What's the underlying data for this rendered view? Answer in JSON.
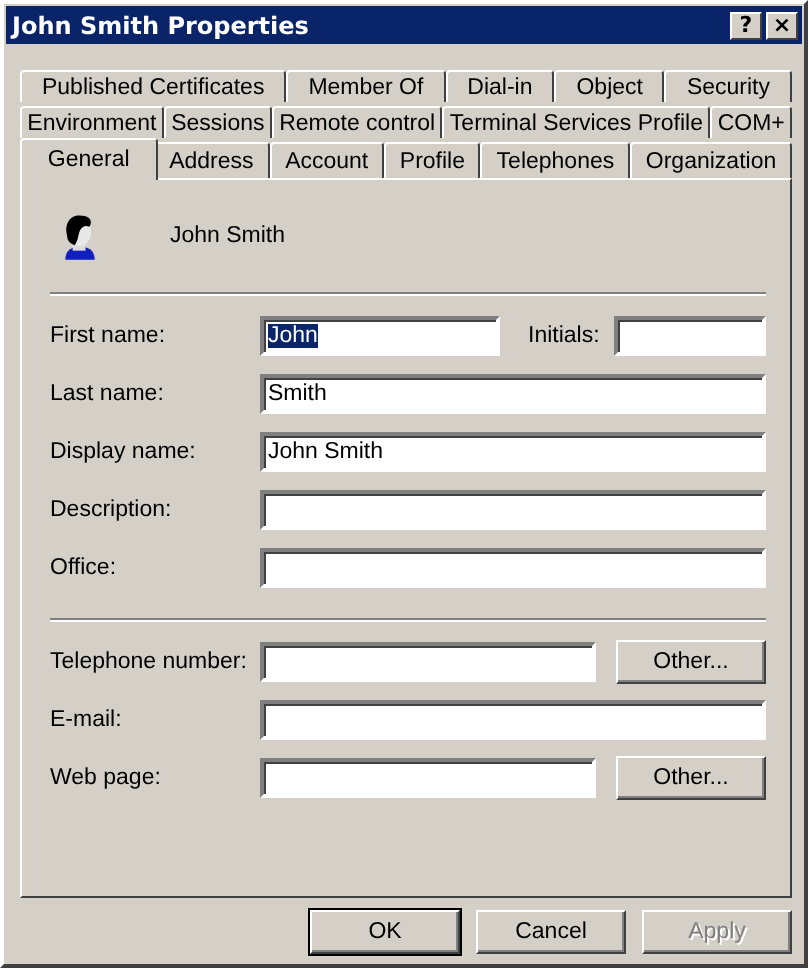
{
  "window": {
    "title": "John Smith Properties",
    "title_buttons": [
      "?",
      "×"
    ]
  },
  "tab_rows": [
    [
      {
        "label": "Published Certificates",
        "selected": false
      },
      {
        "label": "Member Of",
        "selected": false
      },
      {
        "label": "Dial-in",
        "selected": false
      },
      {
        "label": "Object",
        "selected": false
      },
      {
        "label": "Security",
        "selected": false
      }
    ],
    [
      {
        "label": "Environment",
        "selected": false
      },
      {
        "label": "Sessions",
        "selected": false
      },
      {
        "label": "Remote control",
        "selected": false
      },
      {
        "label": "Terminal Services Profile",
        "selected": false
      },
      {
        "label": "COM+",
        "selected": false
      }
    ],
    [
      {
        "label": "General",
        "selected": true
      },
      {
        "label": "Address",
        "selected": false
      },
      {
        "label": "Account",
        "selected": false
      },
      {
        "label": "Profile",
        "selected": false
      },
      {
        "label": "Telephones",
        "selected": false
      },
      {
        "label": "Organization",
        "selected": false
      }
    ]
  ],
  "header": {
    "name": "John Smith"
  },
  "groups": [
    {
      "rows": [
        {
          "label": "First name:",
          "value": "John",
          "text_selected": true,
          "side_field": {
            "label": "Initials:"
          }
        },
        {
          "label": "Last name:",
          "value": "Smith",
          "text_selected": false
        },
        {
          "label": "Display name:",
          "value": "John Smith",
          "text_selected": false
        },
        {
          "label": "Description:"
        },
        {
          "label": "Office:"
        }
      ]
    },
    {
      "rows": [
        {
          "label": "Telephone number:",
          "button": "Other..."
        },
        {
          "label": "E-mail:"
        },
        {
          "label": "Web page:",
          "button": "Other..."
        }
      ]
    }
  ],
  "buttons": [
    {
      "label": "OK",
      "default": true,
      "disabled": false
    },
    {
      "label": "Cancel",
      "default": false,
      "disabled": false
    },
    {
      "label": "Apply",
      "default": false,
      "disabled": true
    }
  ]
}
